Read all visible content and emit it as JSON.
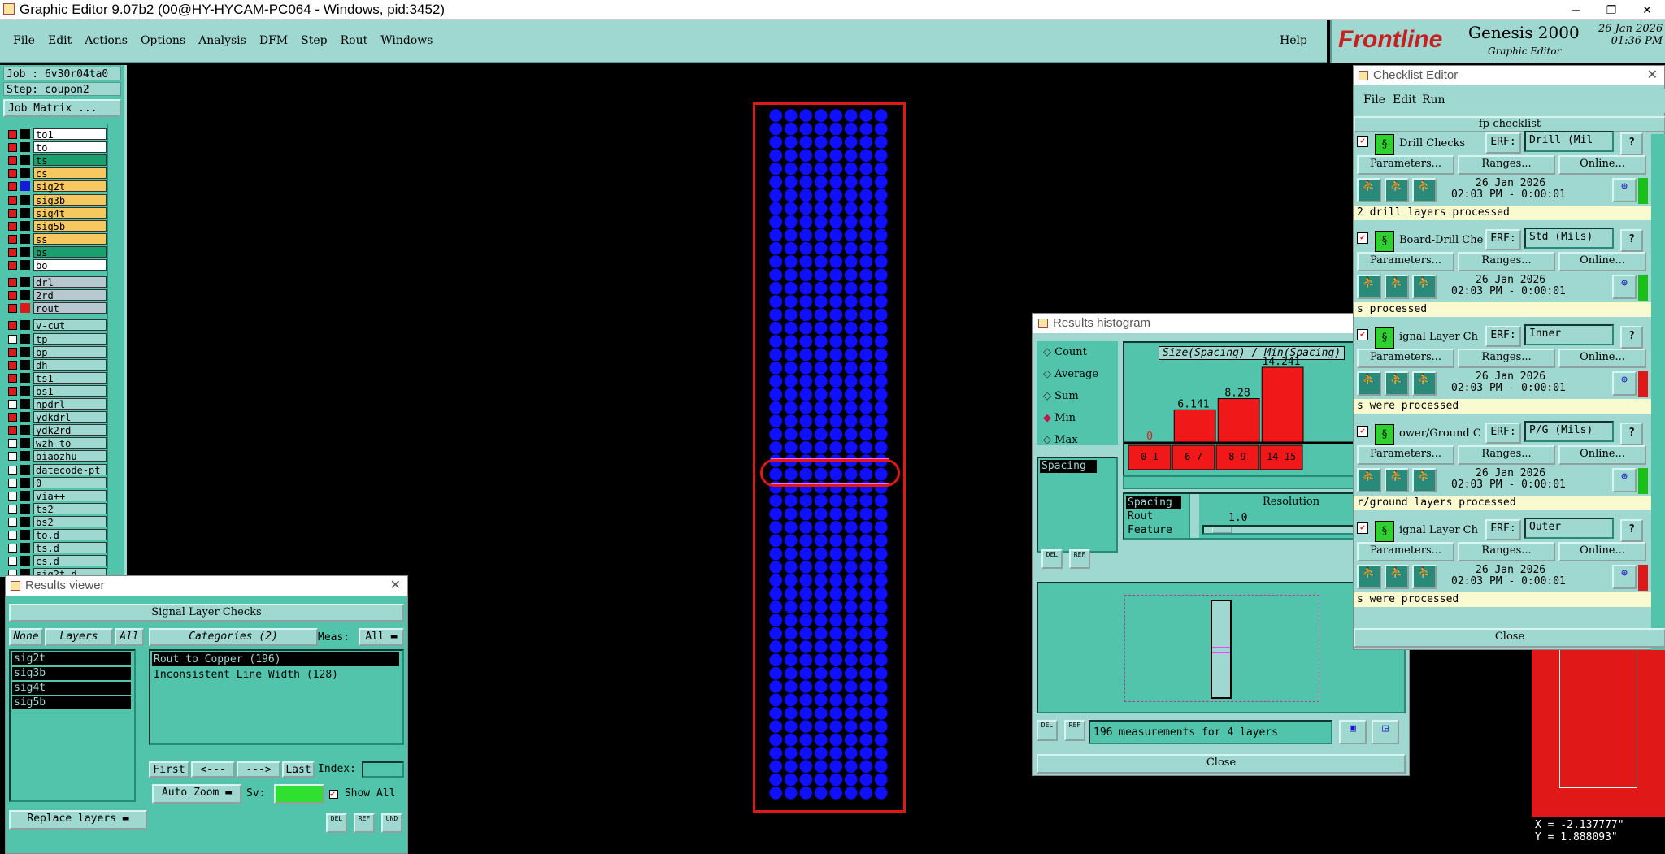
{
  "window": {
    "title": "Graphic Editor 9.07b2 (00@HY-HYCAM-PC064 - Windows, pid:3452)",
    "min": "─",
    "max": "❐",
    "close": "✕"
  },
  "menu": [
    "File",
    "Edit",
    "Actions",
    "Options",
    "Analysis",
    "DFM",
    "Step",
    "Rout",
    "Windows"
  ],
  "help": "Help",
  "brand": {
    "logo": "Frontline",
    "product": "Genesis 2000",
    "sub": "Graphic Editor",
    "date": "26 Jan 2026",
    "time": "01:36 PM"
  },
  "left": {
    "job": "Job : 6v30r04ta0",
    "step": "Step: coupon2",
    "job_matrix": "Job Matrix ...",
    "layers": [
      {
        "name": "to1",
        "checked": true,
        "color": "#ffffff"
      },
      {
        "name": "to",
        "checked": true,
        "color": "#ffffff"
      },
      {
        "name": "ts",
        "checked": true,
        "color": "#1aa06e"
      },
      {
        "name": "cs",
        "checked": true,
        "color": "#f8c860"
      },
      {
        "name": "sig2t",
        "checked": true,
        "color": "#f8c860",
        "active": true
      },
      {
        "name": "sig3b",
        "checked": true,
        "color": "#f8c860"
      },
      {
        "name": "sig4t",
        "checked": true,
        "color": "#f8c860"
      },
      {
        "name": "sig5b",
        "checked": true,
        "color": "#f8c860"
      },
      {
        "name": "ss",
        "checked": true,
        "color": "#f8c860"
      },
      {
        "name": "bs",
        "checked": true,
        "color": "#1aa06e"
      },
      {
        "name": "bo",
        "checked": true,
        "color": "#ffffff"
      },
      {
        "name": "drl",
        "checked": true,
        "color": "#b8c8d0",
        "gap": true
      },
      {
        "name": "2rd",
        "checked": true,
        "color": "#b8c8d0"
      },
      {
        "name": "rout",
        "checked": true,
        "color": "#b8c8d0",
        "red": true
      },
      {
        "name": "v-cut",
        "checked": true,
        "color": "#9fd8d0",
        "gap": true
      },
      {
        "name": "tp",
        "checked": false,
        "color": "#9fd8d0"
      },
      {
        "name": "bp",
        "checked": true,
        "color": "#9fd8d0"
      },
      {
        "name": "dh",
        "checked": true,
        "color": "#9fd8d0"
      },
      {
        "name": "ts1",
        "checked": true,
        "color": "#9fd8d0"
      },
      {
        "name": "bs1",
        "checked": true,
        "color": "#9fd8d0"
      },
      {
        "name": "npdrl",
        "checked": false,
        "color": "#9fd8d0"
      },
      {
        "name": "ydkdrl",
        "checked": true,
        "color": "#9fd8d0"
      },
      {
        "name": "ydk2rd",
        "checked": true,
        "color": "#9fd8d0"
      },
      {
        "name": "wzh-to",
        "checked": false,
        "color": "#9fd8d0"
      },
      {
        "name": "biaozhu",
        "checked": false,
        "color": "#9fd8d0"
      },
      {
        "name": "datecode-pt",
        "checked": false,
        "color": "#9fd8d0"
      },
      {
        "name": "0",
        "checked": false,
        "color": "#9fd8d0"
      },
      {
        "name": "via++",
        "checked": false,
        "color": "#9fd8d0"
      },
      {
        "name": "ts2",
        "checked": false,
        "color": "#9fd8d0"
      },
      {
        "name": "bs2",
        "checked": false,
        "color": "#9fd8d0"
      },
      {
        "name": "to.d",
        "checked": false,
        "color": "#9fd8d0"
      },
      {
        "name": "ts.d",
        "checked": false,
        "color": "#9fd8d0"
      },
      {
        "name": "cs.d",
        "checked": false,
        "color": "#9fd8d0"
      },
      {
        "name": "sig2t.d",
        "checked": false,
        "color": "#9fd8d0"
      }
    ]
  },
  "results_viewer": {
    "title": "Results viewer",
    "header": "Signal Layer Checks",
    "none": "None",
    "layers": "Layers",
    "all": "All",
    "categories": "Categories (2)",
    "meas_label": "Meas:",
    "meas_value": "All",
    "layer_list": [
      "sig2t",
      "sig3b",
      "sig4t",
      "sig5b"
    ],
    "category_list": [
      "Rout to Copper (196)",
      "Inconsistent Line Width (128)"
    ],
    "first": "First",
    "prev": "<---",
    "next": "--->",
    "last": "Last",
    "index": "Index:",
    "auto_zoom": "Auto Zoom",
    "sv": "Sv:",
    "show_all": "Show All",
    "replace": "Replace layers",
    "del": "DEL",
    "ref": "REF",
    "und": "UND"
  },
  "histogram": {
    "title": "Results histogram",
    "options": [
      {
        "label": "Count",
        "sel": false
      },
      {
        "label": "Average",
        "sel": false
      },
      {
        "label": "Sum",
        "sel": false
      },
      {
        "label": "Min",
        "sel": true
      },
      {
        "label": "Max",
        "sel": false
      }
    ],
    "list_items": [
      "Spacing"
    ],
    "chart_title": "Size(Spacing) / Min(Spacing)",
    "bars": [
      {
        "label": "0",
        "range": "0-1",
        "value": 0
      },
      {
        "label": "6.141",
        "range": "6-7",
        "value": 6.141
      },
      {
        "label": "8.28",
        "range": "8-9",
        "value": 8.28
      },
      {
        "label": "14.241",
        "range": "14-15",
        "value": 14.241
      }
    ],
    "res_items": [
      "Spacing",
      "Rout",
      "Feature"
    ],
    "resolution": "Resolution",
    "res_value": "1.0",
    "status": "196 measurements for 4 layers",
    "close": "Close",
    "del": "DEL",
    "ref": "REF"
  },
  "checklist": {
    "title": "Checklist Editor",
    "menu": [
      "File",
      "Edit",
      "Run"
    ],
    "name": "fp-checklist",
    "erf": "ERF:",
    "params": "Parameters...",
    "ranges": "Ranges...",
    "online": "Online...",
    "checks": [
      {
        "name": "Drill Checks",
        "erf": "Drill (Mil",
        "date": "26 Jan 2026",
        "time": "02:03 PM - 0:00:01",
        "msg": "2 drill layers processed",
        "status": "#18c018"
      },
      {
        "name": "Board-Drill Che",
        "erf": "Std (Mils)",
        "date": "26 Jan 2026",
        "time": "02:03 PM - 0:00:01",
        "msg": "s processed",
        "status": "#18c018"
      },
      {
        "name": "ignal Layer Ch",
        "erf": "Inner",
        "date": "26 Jan 2026",
        "time": "02:03 PM - 0:00:01",
        "msg": "s were processed",
        "status": "#e01818"
      },
      {
        "name": "ower/Ground C",
        "erf": "P/G (Mils)",
        "date": "26 Jan 2026",
        "time": "02:03 PM - 0:00:01",
        "msg": "r/ground layers processed",
        "status": "#18c018"
      },
      {
        "name": "ignal Layer Ch",
        "erf": "Outer",
        "date": "26 Jan 2026",
        "time": "02:03 PM - 0:00:01",
        "msg": "s were processed",
        "status": "#e01818"
      }
    ],
    "close": "Close"
  },
  "coords": {
    "x": "X = -2.137777\"",
    "y": "Y = 1.888093\""
  }
}
